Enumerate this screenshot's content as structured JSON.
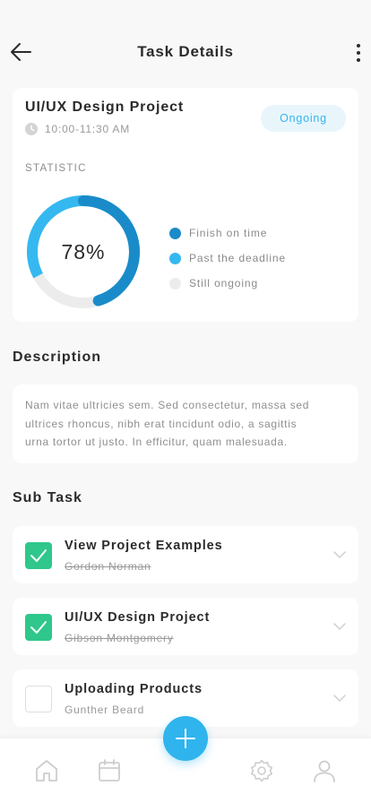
{
  "header": {
    "title": "Task Details"
  },
  "project": {
    "title": "UI/UX Design Project",
    "time": "10:00-11:30 AM",
    "status": "Ongoing"
  },
  "statistic": {
    "label": "STATISTIC",
    "value_label": "78%",
    "progress_fraction": 0.78,
    "legend": [
      {
        "label": "Finish on time",
        "color": "#1a8bc9"
      },
      {
        "label": "Past the deadline",
        "color": "#35b8f0"
      },
      {
        "label": "Still ongoing",
        "color": "#ececec"
      }
    ]
  },
  "description": {
    "title": "Description",
    "lines": [
      "Nam vitae ultricies sem. Sed consectetur, massa sed",
      "ultrices rhoncus, nibh erat tincidunt odio, a sagittis",
      "urna tortor ut justo. In efficitur, quam malesuada."
    ]
  },
  "subtasks": {
    "title": "Sub Task",
    "items": [
      {
        "title": "View Project Examples",
        "assignee": "Gordon Norman",
        "done": true
      },
      {
        "title": "UI/UX Design Project",
        "assignee": "Gibson Montgomery",
        "done": true
      },
      {
        "title": "Uploading Products",
        "assignee": "Gunther Beard",
        "done": false
      }
    ]
  },
  "tabbar": {
    "icons": [
      "home-icon",
      "calendar-icon",
      "add-icon",
      "settings-icon",
      "profile-icon"
    ]
  },
  "colors": {
    "accent": "#2fb4ee",
    "success": "#2fc78b"
  }
}
